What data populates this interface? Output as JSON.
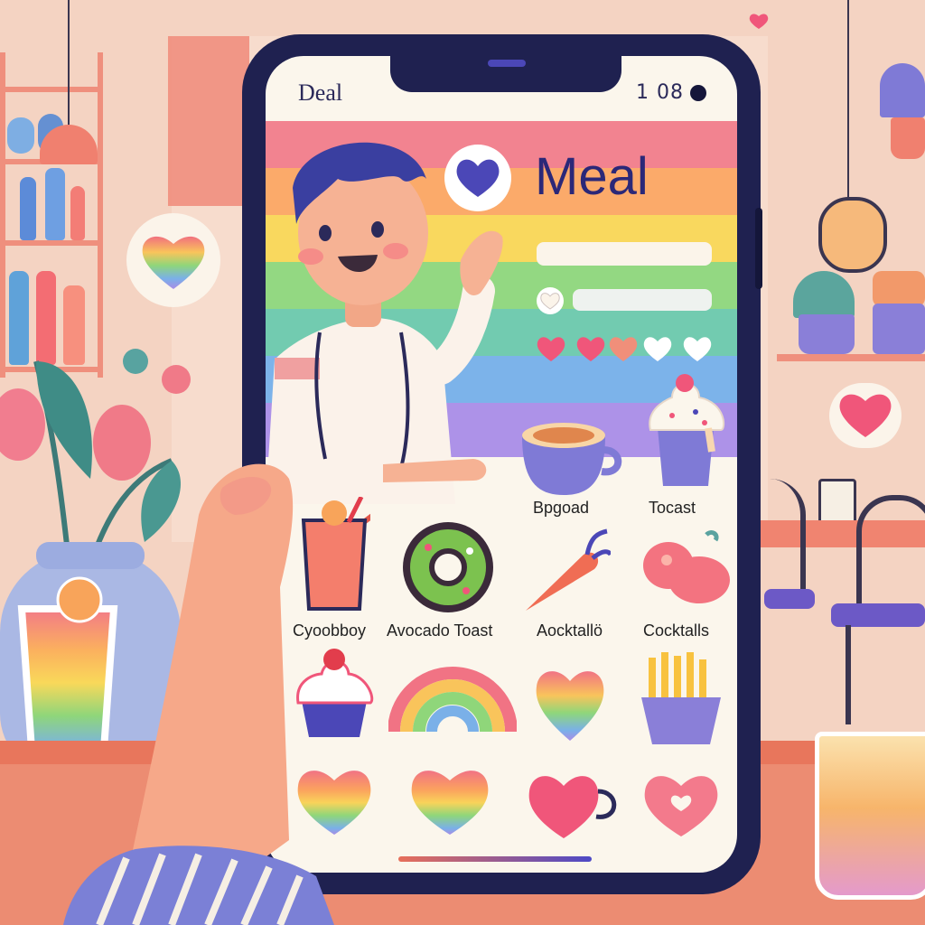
{
  "status_bar": {
    "app_name": "Deal",
    "time": "1 08"
  },
  "header": {
    "title": "Meal"
  },
  "menu": {
    "row1": [
      "Bpgoad",
      "Tocast"
    ],
    "row2": [
      "Cyoobboy",
      "Avocado Toast",
      "Aocktallö",
      "Cocktalls"
    ]
  },
  "colors": {
    "phone_frame": "#1f2150",
    "screen_bg": "#fbf6ec",
    "rainbow": [
      "#f17a8e",
      "#fba25e",
      "#f9d35a",
      "#8fd67a",
      "#6dc9ae",
      "#7ab0e8",
      "#a98ce6"
    ],
    "heart_pink": "#f0567a",
    "brand_purple": "#4b47b7"
  },
  "icons": [
    "heart-icon",
    "coffee-cup-icon",
    "cupcake-icon",
    "cocktail-glass-icon",
    "donut-icon",
    "carrot-icon",
    "sausage-icon",
    "rainbow-icon",
    "rainbow-heart-icon",
    "fries-icon",
    "heart-mug-icon"
  ]
}
